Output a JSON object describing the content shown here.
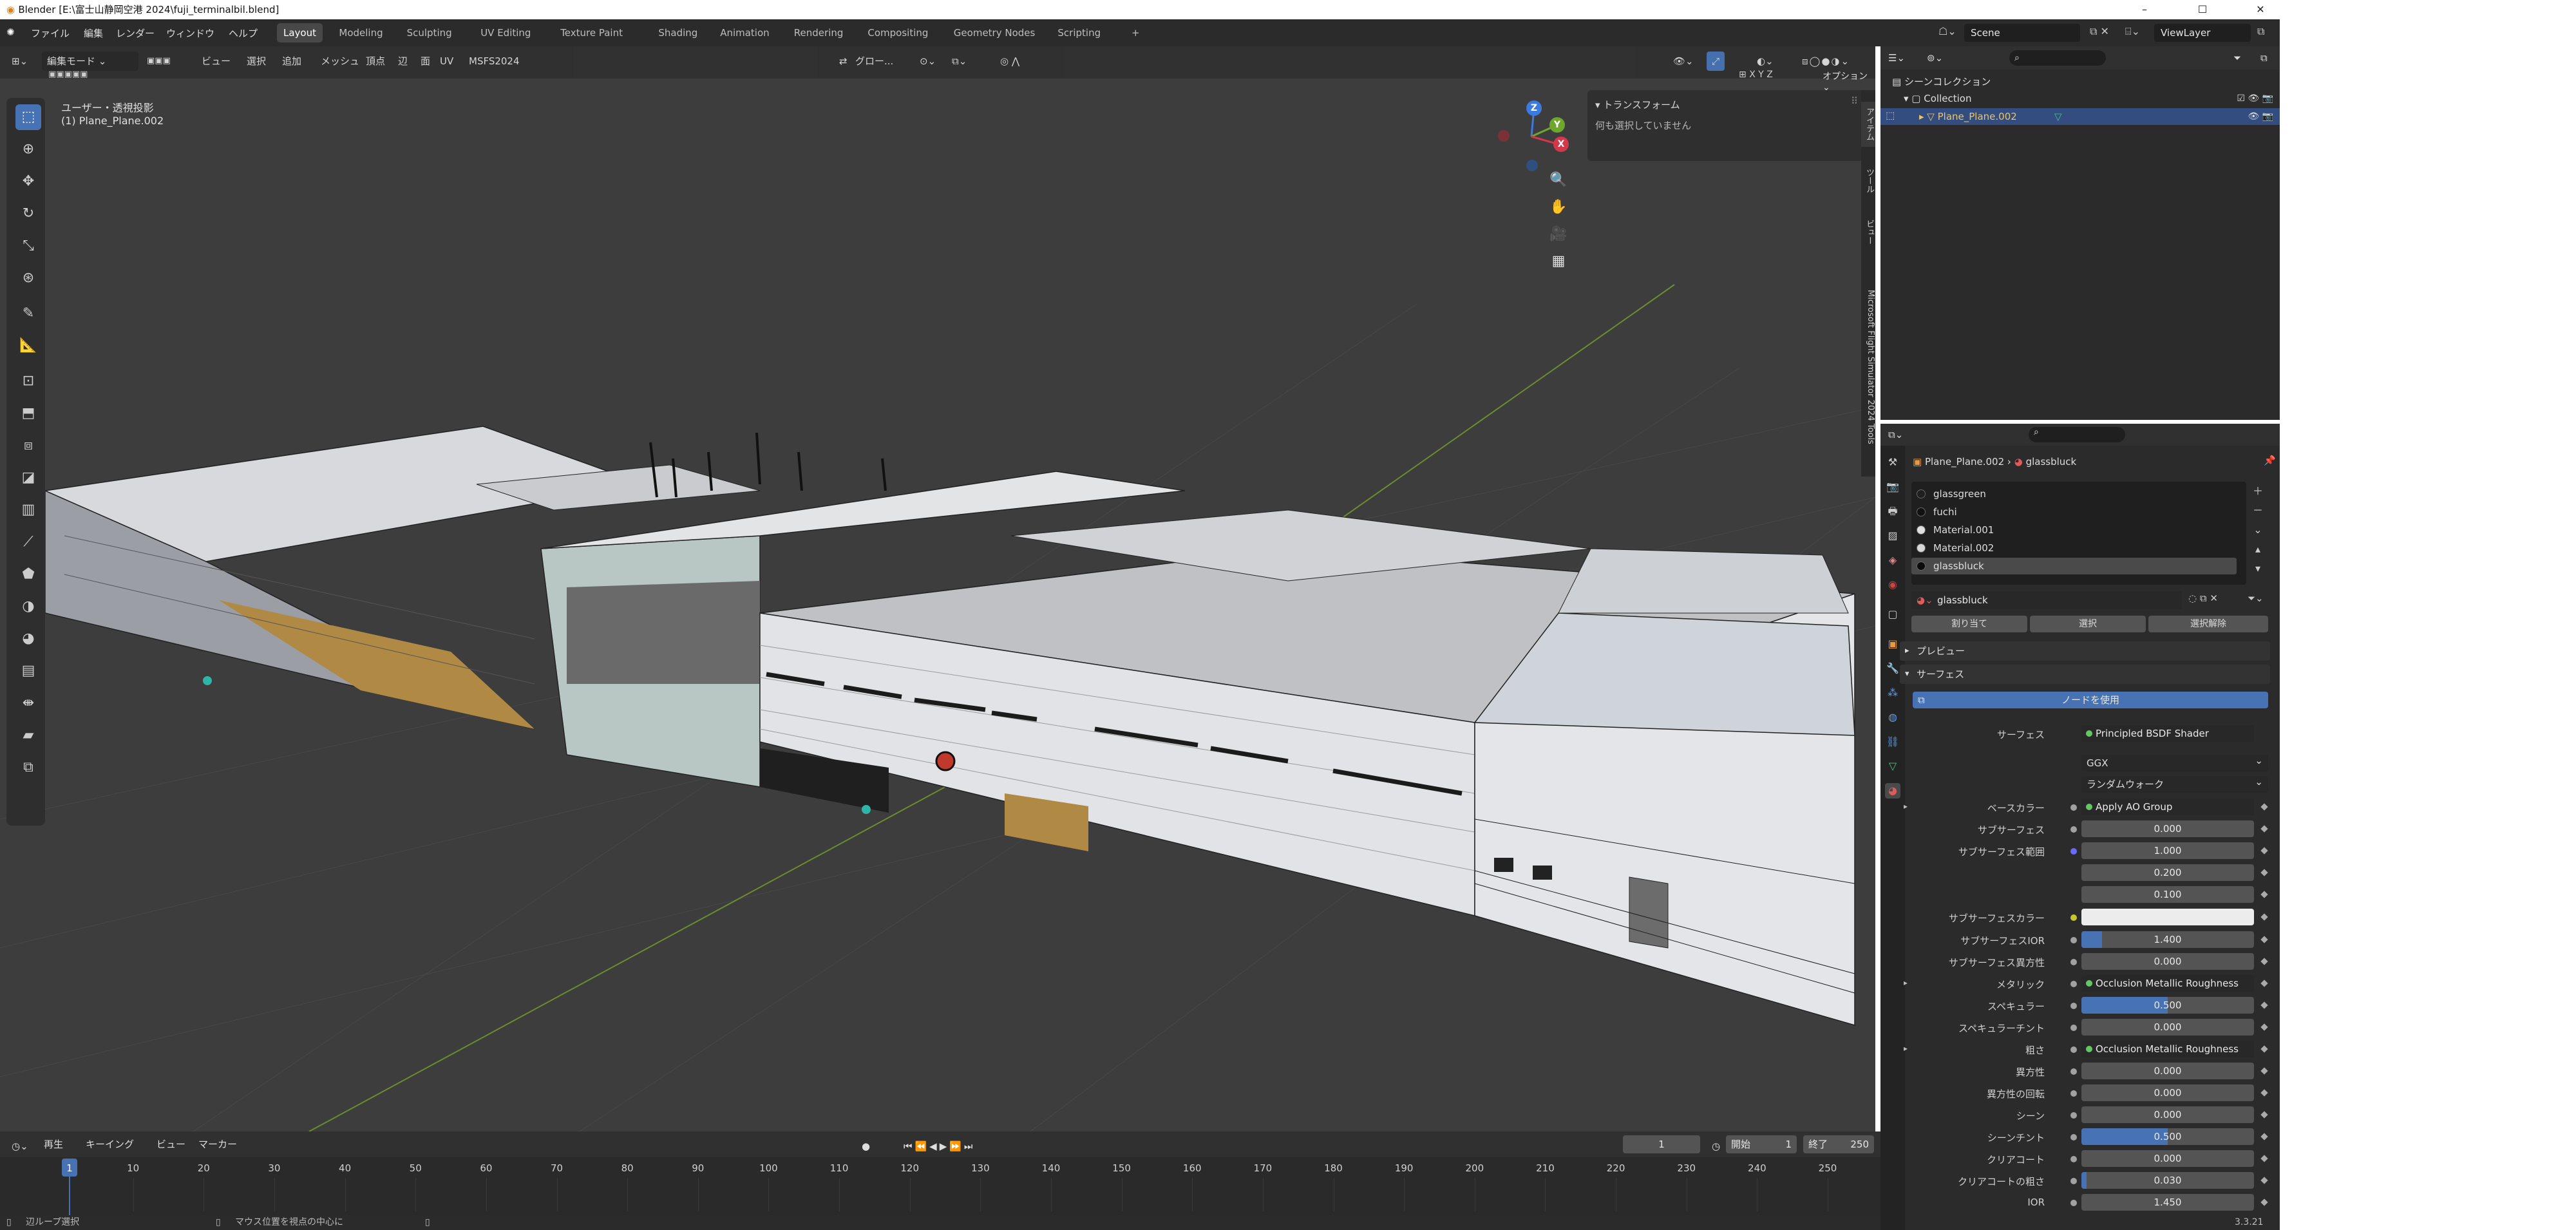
{
  "window": {
    "title": "Blender [E:\\富士山静岡空港 2024\\fuji_terminalbil.blend]",
    "controls": [
      "–",
      "☐",
      "✕"
    ]
  },
  "menubar": {
    "items": [
      "ファイル",
      "編集",
      "レンダー",
      "ウィンドウ",
      "ヘルプ"
    ]
  },
  "workspaces": [
    {
      "label": "Layout",
      "active": true
    },
    {
      "label": "Modeling"
    },
    {
      "label": "Sculpting"
    },
    {
      "label": "UV Editing"
    },
    {
      "label": "Texture Paint"
    },
    {
      "label": "Shading"
    },
    {
      "label": "Animation"
    },
    {
      "label": "Rendering"
    },
    {
      "label": "Compositing"
    },
    {
      "label": "Geometry Nodes"
    },
    {
      "label": "Scripting"
    },
    {
      "label": "+"
    }
  ],
  "scene": {
    "name": "Scene",
    "view_layer": "ViewLayer"
  },
  "viewport": {
    "mode": "編集モード",
    "menus": [
      "ビュー",
      "選択",
      "追加",
      "メッシュ",
      "頂点",
      "辺",
      "面",
      "UV",
      "MSFS2024"
    ],
    "transform_orientation": "グロー...",
    "options": "オプション",
    "axis_toggles": [
      "X",
      "Y",
      "Z"
    ],
    "overlay_title": "ユーザー・透視投影",
    "overlay_object": "(1) Plane_Plane.002",
    "npanel": {
      "header": "トランスフォーム",
      "message": "何も選択していません"
    },
    "side_tabs": [
      "アイテム",
      "ツール",
      "ビュー",
      "Microsoft Flight Simulator 2024 Tools"
    ],
    "gizmo": {
      "x": "X",
      "y": "Y",
      "z": "Z"
    }
  },
  "timeline": {
    "menus": [
      "再生",
      "キーイング",
      "ビュー",
      "マーカー"
    ],
    "current_frame": "1",
    "start_label": "開始",
    "start": "1",
    "end_label": "終了",
    "end": "250",
    "ticks": [
      "1",
      "10",
      "20",
      "30",
      "40",
      "50",
      "60",
      "70",
      "80",
      "90",
      "100",
      "110",
      "120",
      "130",
      "140",
      "150",
      "160",
      "170",
      "180",
      "190",
      "200",
      "210",
      "220",
      "230",
      "240",
      "250"
    ]
  },
  "statusbar": {
    "left": "辺ループ選択",
    "middle": "マウス位置を視点の中心に",
    "version": "3.3.21"
  },
  "outliner": {
    "search_placeholder": "",
    "root": "シーンコレクション",
    "collection": "Collection",
    "object": "Plane_Plane.002"
  },
  "properties": {
    "breadcrumb_object": "Plane_Plane.002",
    "breadcrumb_material": "glassbluck",
    "materials": [
      {
        "name": "glassgreen",
        "color": "#1f1f1f"
      },
      {
        "name": "fuchi",
        "color": "#111111"
      },
      {
        "name": "Material.001",
        "color": "#e0e0e0"
      },
      {
        "name": "Material.002",
        "color": "#d8d8d8"
      },
      {
        "name": "glassbluck",
        "color": "#0a0a0a",
        "selected": true
      }
    ],
    "active_material": "glassbluck",
    "buttons": [
      "割り当て",
      "選択",
      "選択解除"
    ],
    "sections": {
      "preview": "プレビュー",
      "surface": "サーフェス"
    },
    "use_nodes": "ノードを使用",
    "surface": {
      "label": "サーフェス",
      "value": "Principled BSDF Shader"
    },
    "distribution": "GGX",
    "subsurface_method": "ランダムウォーク",
    "rows": [
      {
        "label": "ベースカラー",
        "value": "Apply AO Group",
        "kind": "link",
        "expand": true
      },
      {
        "label": "サブサーフェス",
        "value": "0.000",
        "fill": 0
      },
      {
        "label": "サブサーフェス範囲",
        "value": "1.000",
        "fill": 0,
        "dot": "#6a6aff"
      },
      {
        "label": "",
        "value": "0.200",
        "fill": 0,
        "nodot": true
      },
      {
        "label": "",
        "value": "0.100",
        "fill": 0,
        "nodot": true
      },
      {
        "label": "サブサーフェスカラー",
        "value": "",
        "kind": "color",
        "dot": "#c7c729"
      },
      {
        "label": "サブサーフェスIOR",
        "value": "1.400",
        "fill": 0.12
      },
      {
        "label": "サブサーフェス異方性",
        "value": "0.000",
        "fill": 0
      },
      {
        "label": "メタリック",
        "value": "Occlusion Metallic Roughness Group",
        "kind": "link",
        "expand": true
      },
      {
        "label": "スペキュラー",
        "value": "0.500",
        "fill": 0.5
      },
      {
        "label": "スペキュラーチント",
        "value": "0.000",
        "fill": 0
      },
      {
        "label": "粗さ",
        "value": "Occlusion Metallic Roughness Group",
        "kind": "link",
        "expand": true
      },
      {
        "label": "異方性",
        "value": "0.000",
        "fill": 0
      },
      {
        "label": "異方性の回転",
        "value": "0.000",
        "fill": 0
      },
      {
        "label": "シーン",
        "value": "0.000",
        "fill": 0
      },
      {
        "label": "シーンチント",
        "value": "0.500",
        "fill": 0.5
      },
      {
        "label": "クリアコート",
        "value": "0.000",
        "fill": 0
      },
      {
        "label": "クリアコートの粗さ",
        "value": "0.030",
        "fill": 0.03
      },
      {
        "label": "IOR",
        "value": "1.450",
        "fill": 0
      }
    ]
  }
}
